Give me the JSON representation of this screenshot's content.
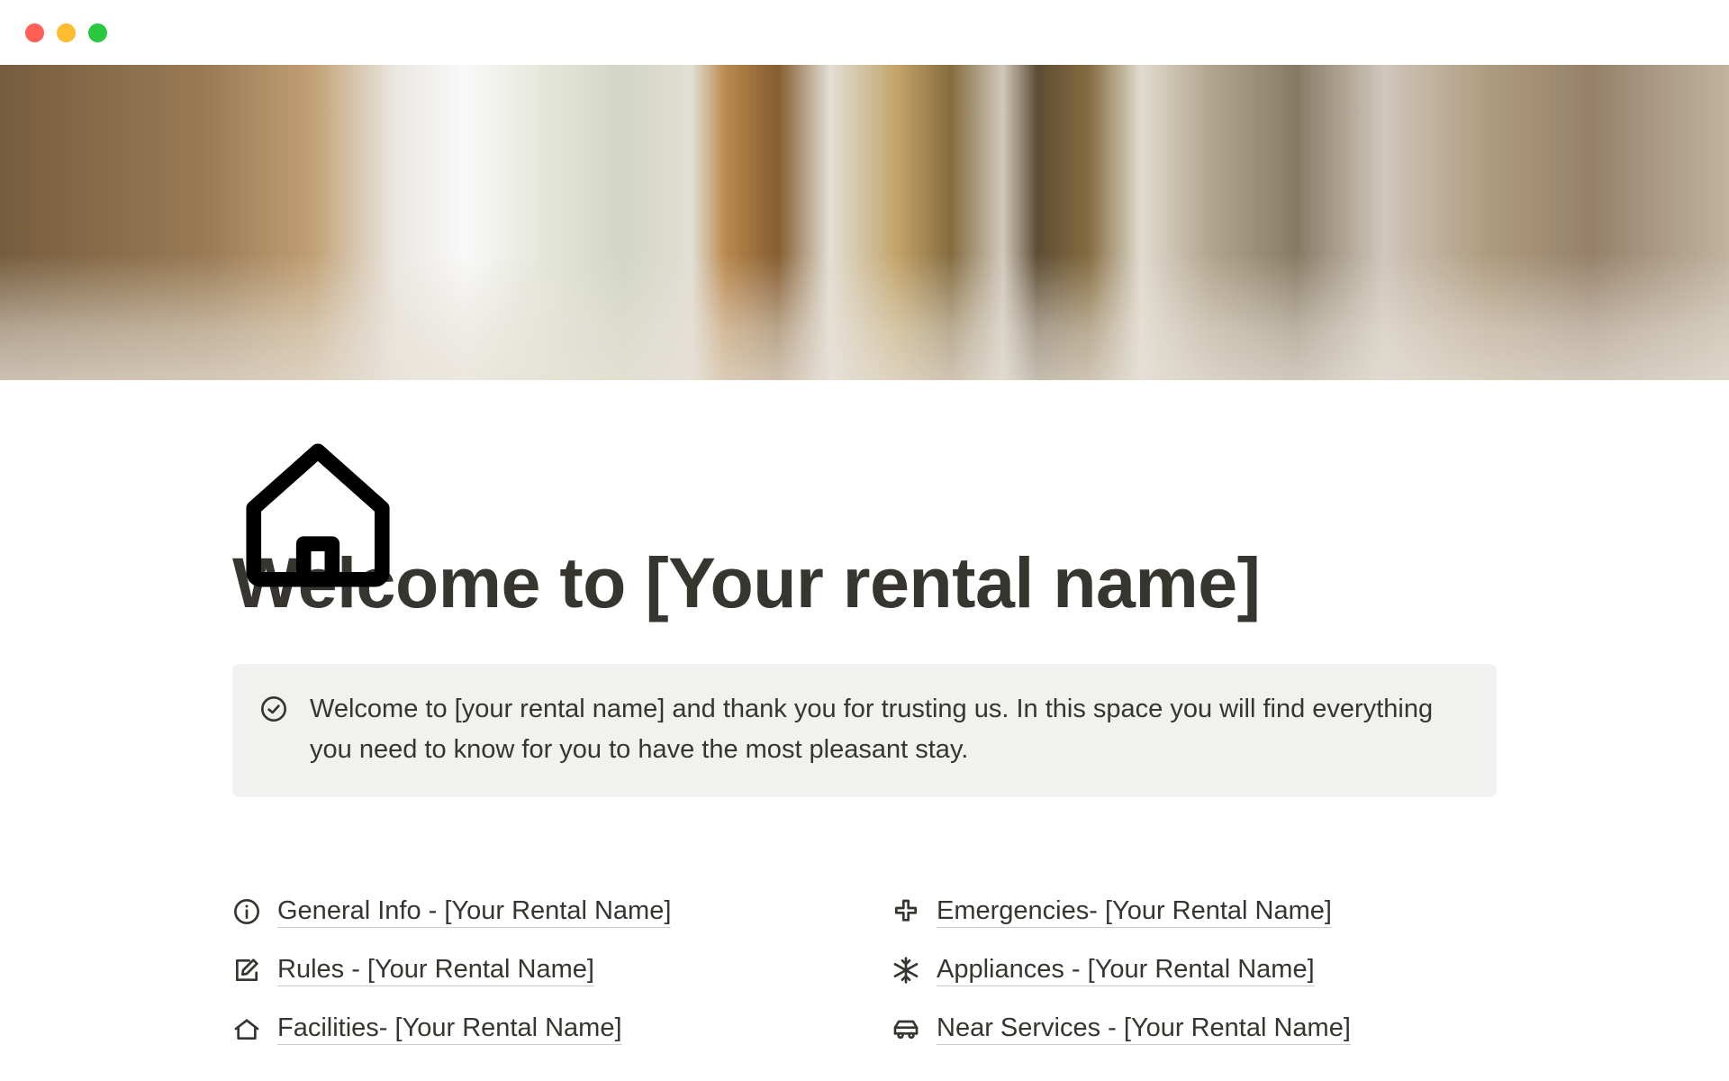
{
  "page": {
    "title": "Welcome to [Your rental name]"
  },
  "callout": {
    "text": "Welcome to [your rental name] and thank you for trusting us. In this space you will find everything you need to know for you to have the most pleasant stay."
  },
  "links": {
    "left": [
      {
        "icon": "info",
        "label": "General Info - [Your Rental Name]"
      },
      {
        "icon": "edit",
        "label": "Rules - [Your Rental Name]"
      },
      {
        "icon": "house",
        "label": "Facilities- [Your Rental Name]"
      }
    ],
    "right": [
      {
        "icon": "plus-med",
        "label": "Emergencies- [Your Rental Name]"
      },
      {
        "icon": "snowflake",
        "label": "Appliances - [Your Rental Name]"
      },
      {
        "icon": "car",
        "label": "Near Services - [Your Rental Name]"
      }
    ]
  }
}
